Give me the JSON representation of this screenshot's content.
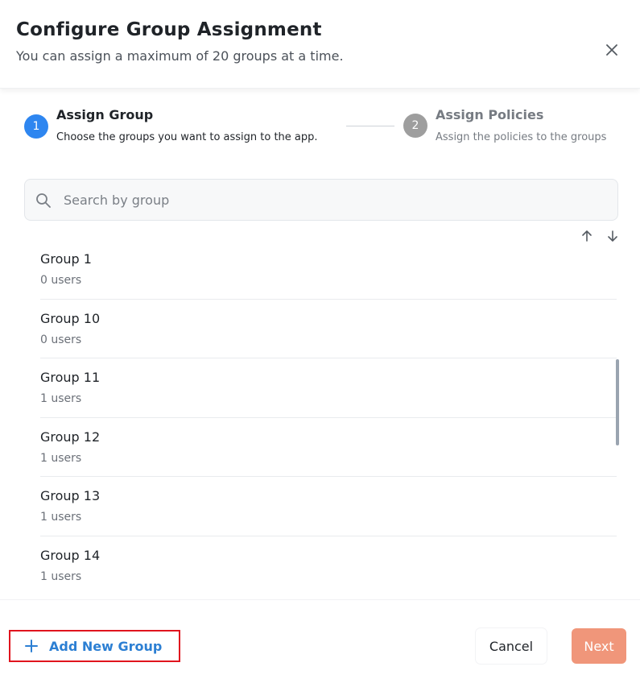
{
  "dialog": {
    "title": "Configure Group Assignment",
    "subtitle": "You can assign a maximum of 20 groups at a time."
  },
  "stepper": {
    "steps": [
      {
        "number": "1",
        "title": "Assign Group",
        "description": "Choose the groups you want to assign to the app.",
        "state": "active",
        "color": "#2e86f0"
      },
      {
        "number": "2",
        "title": "Assign Policies",
        "description": "Assign the policies to the groups",
        "state": "inactive",
        "color": "#9e9e9e"
      }
    ]
  },
  "search": {
    "placeholder": "Search by group",
    "value": ""
  },
  "groups": [
    {
      "name": "Group 1",
      "users": "0 users"
    },
    {
      "name": "Group 10",
      "users": "0 users"
    },
    {
      "name": "Group 11",
      "users": "1 users"
    },
    {
      "name": "Group 12",
      "users": "1 users"
    },
    {
      "name": "Group 13",
      "users": "1 users"
    },
    {
      "name": "Group 14",
      "users": "1 users"
    }
  ],
  "footer": {
    "add_group_label": "Add New Group",
    "cancel_label": "Cancel",
    "next_label": "Next"
  },
  "colors": {
    "accent": "#2e86f0",
    "link": "#2c7fd3",
    "next_button": "#f0967a",
    "highlight_border": "#e0141e"
  },
  "icons": {
    "close": "close-icon",
    "search": "search-icon",
    "sort_up": "arrow-up-icon",
    "sort_down": "arrow-down-icon",
    "add": "plus-icon"
  }
}
